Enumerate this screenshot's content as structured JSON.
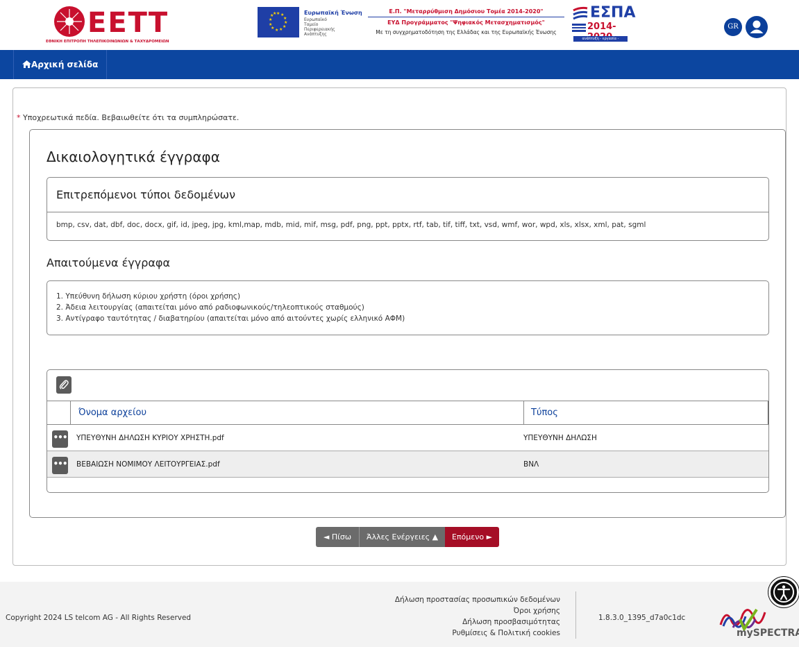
{
  "header": {
    "eett_word": "ΕΕΤΤ",
    "eett_subtitle": "ΕΘΝΙΚΗ ΕΠΙΤΡΟΠΗ ΤΗΛΕΠΙΚΟΙΝΩΝΙΩΝ & ΤΑΧΥΔΡΟΜΕΙΩΝ",
    "eu_title": "Ευρωπαϊκή Ένωση",
    "eu_subtitle": "Ευρωπαϊκό Ταμείο Περιφερειακής Ανάπτυξης",
    "op_line1": "Ε.Π. \"Μεταρρύθμιση Δημόσιου Τομέα 2014-2020\"",
    "op_line2": "ΕΥΔ Προγράμματος \"Ψηφιακός Μετασχηματισμός\"",
    "op_line3": "Με τη συγχρηματοδότηση της Ελλάδας και της Ευρωπαϊκής Ένωσης",
    "espa_word": "ΕΣΠΑ",
    "espa_years": "2014-2020",
    "espa_band": "ανάπτυξη - εργασία - αλληλεγγύη",
    "lang_label": "GR",
    "brand_red": "#c8102e",
    "brand_blue": "#0b3f9a"
  },
  "nav": {
    "home_label": "Αρχική σελίδα",
    "bar_color": "#0c46a0"
  },
  "form": {
    "required_note": "Υποχρεωτικά πεδία. Βεβαιωθείτε ότι τα συμπληρώσατε.",
    "section_title": "Δικαιολογητικά έγγραφα",
    "allowed_types_title": "Επιτρεπόμενοι τύποι δεδομένων",
    "allowed_types": "bmp, csv, dat, dbf, doc, docx, gif, id, jpeg, jpg, kml,map, mdb, mid, mif, msg, pdf, png, ppt, pptx, rtf, tab, tif, tiff, txt, vsd, wmf, wor, wpd, xls, xlsx, xml, pat, sgml",
    "required_docs_title": "Απαιτούμενα έγγραφα",
    "required_docs": [
      "1. Υπεύθυνη δήλωση κύριου χρήστη (όροι χρήσης)",
      "2. Άδεια λειτουργίας (απαιτείται μόνο από ραδιοφωνικούς/τηλεοπτικούς σταθμούς)",
      "3. Αντίγραφο ταυτότητας / διαβατηρίου (απαιτείται μόνο από αιτούντες χωρίς ελληνικό ΑΦΜ)"
    ]
  },
  "files_table": {
    "columns": [
      "Όνομα αρχείου",
      "Τύπος"
    ],
    "rows": [
      {
        "name": "ΥΠΕΥΘΥΝΗ ΔΗΛΩΣΗ ΚΥΡΙΟΥ ΧΡΗΣΤΗ.pdf",
        "type": "ΥΠΕΥΘΥΝΗ ΔΗΛΩΣΗ"
      },
      {
        "name": "ΒΕΒΑΙΩΣΗ ΝΟΜΙΜΟΥ ΛΕΙΤΟΥΡΓΕΙΑΣ.pdf",
        "type": "ΒΝΛ"
      }
    ]
  },
  "actions": {
    "back_label": "◄ Πίσω",
    "more_label": "Άλλες Ενέργειες ▲",
    "next_label": "Επόμενο ►"
  },
  "footer": {
    "copyright": "Copyright 2024 LS telcom AG - All Rights Reserved",
    "links": [
      "Δήλωση προστασίας προσωπικών δεδομένων",
      "Όροι χρήσης",
      "Δήλωση προσβασιμότητας",
      "Ρυθμίσεις & Πολιτική cookies"
    ],
    "version": "1.8.3.0_1395_d7a0c1dc",
    "spectra_word": "mySPECTRA"
  }
}
